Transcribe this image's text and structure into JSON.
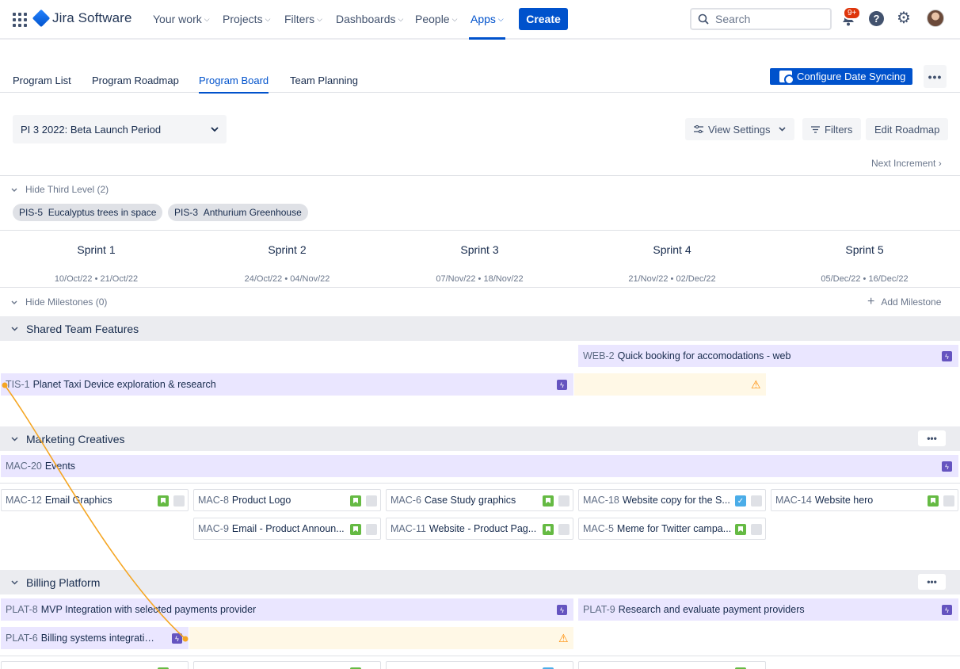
{
  "topnav": {
    "product": "Jira Software",
    "items": [
      {
        "label": "Your work"
      },
      {
        "label": "Projects"
      },
      {
        "label": "Filters"
      },
      {
        "label": "Dashboards"
      },
      {
        "label": "People"
      },
      {
        "label": "Apps"
      }
    ],
    "create_label": "Create",
    "search_placeholder": "Search",
    "notification_badge": "9+",
    "help_glyph": "?",
    "accent_color": "#0052CC"
  },
  "tabs": {
    "items": [
      {
        "label": "Program List"
      },
      {
        "label": "Program Roadmap"
      },
      {
        "label": "Program Board"
      },
      {
        "label": "Team Planning"
      }
    ],
    "configure_label": "Configure Date Syncing",
    "more_label": "•••"
  },
  "toolbar": {
    "increment": "PI 3 2022: Beta Launch Period",
    "view_settings": "View Settings",
    "filters": "Filters",
    "edit_roadmap": "Edit Roadmap",
    "next_increment": "Next Increment"
  },
  "third_level": {
    "toggle": "Hide Third Level (2)",
    "pills": [
      {
        "key": "PIS-5",
        "label": "Eucalyptus trees in space"
      },
      {
        "key": "PIS-3",
        "label": "Anthurium Greenhouse"
      }
    ]
  },
  "sprints": [
    {
      "name": "Sprint 1",
      "dates": "10/Oct/22 • 21/Oct/22"
    },
    {
      "name": "Sprint 2",
      "dates": "24/Oct/22 • 04/Nov/22"
    },
    {
      "name": "Sprint 3",
      "dates": "07/Nov/22 • 18/Nov/22"
    },
    {
      "name": "Sprint 4",
      "dates": "21/Nov/22 • 02/Dec/22"
    },
    {
      "name": "Sprint 5",
      "dates": "05/Dec/22 • 16/Dec/22"
    }
  ],
  "milestones": {
    "toggle": "Hide Milestones (0)",
    "add_label": "Add Milestone"
  },
  "groups": {
    "shared": {
      "title": "Shared Team Features",
      "features": [
        {
          "key": "WEB-2",
          "summary": "Quick booking for accomodations - web"
        },
        {
          "key": "TIS-1",
          "summary": "Planet Taxi Device exploration & research"
        }
      ]
    },
    "marketing": {
      "title": "Marketing Creatives",
      "more": "•••",
      "features": [
        {
          "key": "MAC-20",
          "summary": "Events"
        }
      ],
      "cards": [
        {
          "key": "MAC-12",
          "summary": "Email Graphics"
        },
        {
          "key": "MAC-8",
          "summary": "Product Logo"
        },
        {
          "key": "MAC-6",
          "summary": "Case Study graphics"
        },
        {
          "key": "MAC-18",
          "summary": "Website copy for the S..."
        },
        {
          "key": "MAC-14",
          "summary": "Website hero"
        },
        {
          "key": "MAC-9",
          "summary": "Email - Product Announ..."
        },
        {
          "key": "MAC-11",
          "summary": "Website - Product Pag..."
        },
        {
          "key": "MAC-5",
          "summary": "Meme for Twitter campa..."
        }
      ]
    },
    "billing": {
      "title": "Billing Platform",
      "more": "•••",
      "features": [
        {
          "key": "PLAT-8",
          "summary": "MVP Integration with selected payments provider"
        },
        {
          "key": "PLAT-9",
          "summary": "Research and evaluate payment providers"
        },
        {
          "key": "PLAT-6",
          "summary": "Billing systems integration ..."
        }
      ]
    }
  },
  "icons": {
    "epic": "lightning-icon",
    "story": "bookmark-icon",
    "task": "checkbox-icon",
    "warning": "warning-icon"
  },
  "colors": {
    "epic": "#6554C0",
    "story": "#65BA43",
    "task": "#4BADE8",
    "warning": "#FF8B00",
    "feature_bg": "#EAE6FF",
    "dependency_line": "#F5A623"
  }
}
